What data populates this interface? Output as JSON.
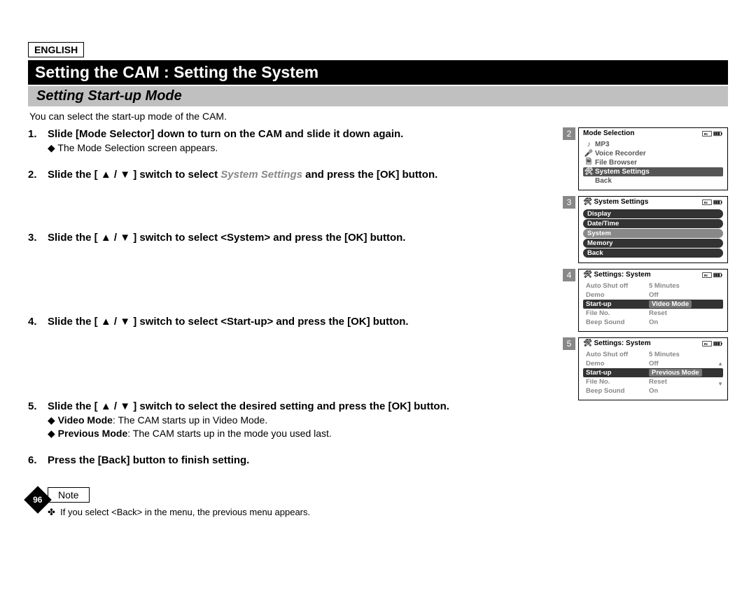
{
  "language": "ENGLISH",
  "title": "Setting the CAM : Setting the System",
  "section": "Setting Start-up Mode",
  "intro": "You can select the start-up mode of the CAM.",
  "steps": [
    {
      "num": "1.",
      "text": "Slide [Mode Selector] down to turn on the CAM and slide it down again.",
      "subs": [
        "The Mode Selection screen appears."
      ]
    },
    {
      "num": "2.",
      "text_pre": "Slide the [ ▲ / ▼ ] switch to select ",
      "text_hi": "System Settings",
      "text_post": " and press the [OK] button."
    },
    {
      "num": "3.",
      "text": "Slide the [ ▲ / ▼ ] switch to select <System> and press the [OK] button."
    },
    {
      "num": "4.",
      "text": "Slide the [ ▲ / ▼ ] switch to select <Start-up> and press the [OK] button."
    },
    {
      "num": "5.",
      "text": "Slide the [ ▲ / ▼ ] switch to select the desired setting and press the [OK] button.",
      "subs": [
        {
          "b": "Video Mode",
          "t": ": The CAM starts up in Video Mode."
        },
        {
          "b": "Previous Mode",
          "t": ": The CAM starts up in the mode you used last."
        }
      ]
    },
    {
      "num": "6.",
      "text": "Press the [Back] button to finish setting."
    }
  ],
  "note_label": "Note",
  "note_text": "If you select <Back> in the menu, the previous menu appears.",
  "page_number": "96",
  "screens": {
    "s2": {
      "num": "2",
      "title": "Mode Selection",
      "items": [
        "MP3",
        "Voice Recorder",
        "File Browser",
        "System Settings",
        "Back"
      ],
      "selected": 3
    },
    "s3": {
      "num": "3",
      "title": "System Settings",
      "items": [
        "Display",
        "Date/Time",
        "System",
        "Memory",
        "Back"
      ],
      "selected": 2
    },
    "s4": {
      "num": "4",
      "title": "Settings: System",
      "rows": [
        {
          "k": "Auto Shut off",
          "v": "5 Minutes"
        },
        {
          "k": "Demo",
          "v": "Off"
        },
        {
          "k": "Start-up",
          "v": "Video Mode"
        },
        {
          "k": "File No.",
          "v": "Reset"
        },
        {
          "k": "Beep Sound",
          "v": "On"
        }
      ],
      "selected": 2
    },
    "s5": {
      "num": "5",
      "title": "Settings: System",
      "rows": [
        {
          "k": "Auto Shut off",
          "v": "5 Minutes"
        },
        {
          "k": "Demo",
          "v": "Off"
        },
        {
          "k": "Start-up",
          "v": "Previous Mode"
        },
        {
          "k": "File No.",
          "v": "Reset"
        },
        {
          "k": "Beep Sound",
          "v": "On"
        }
      ],
      "selected": 2
    }
  }
}
